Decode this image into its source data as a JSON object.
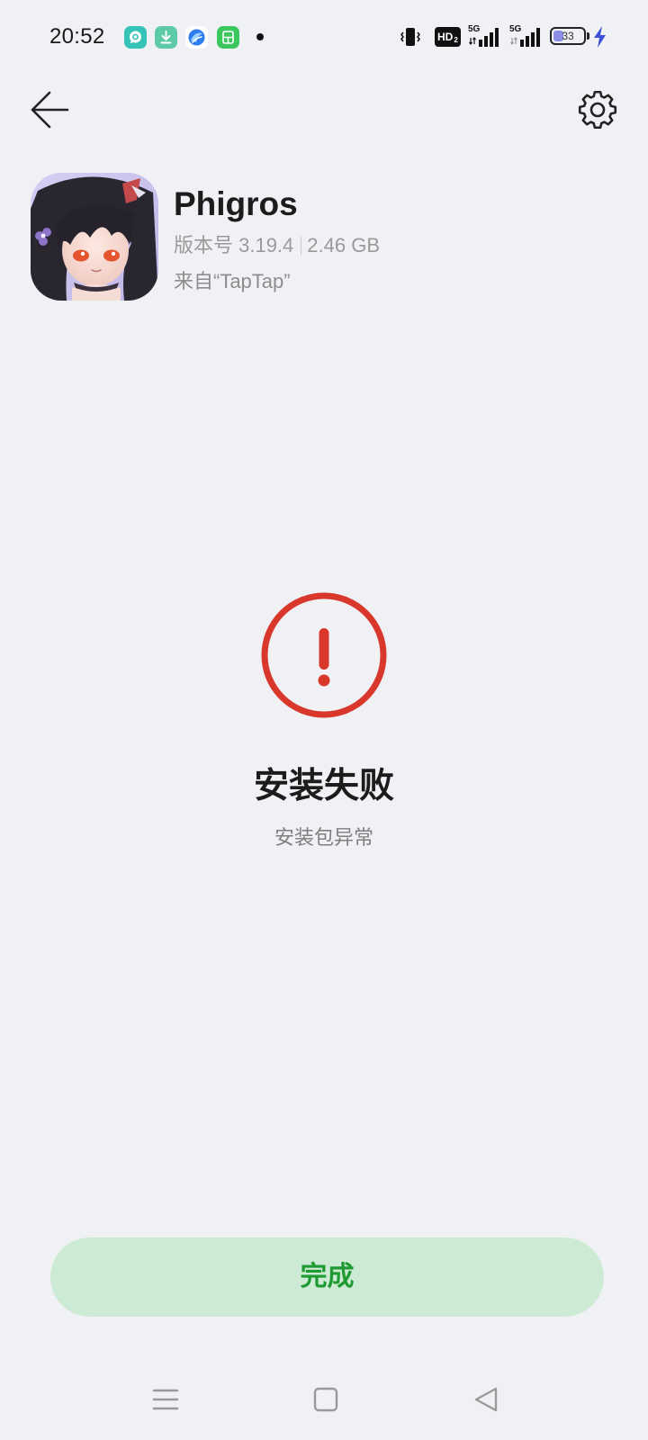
{
  "status_bar": {
    "time": "20:52",
    "notification_icons": [
      "chat-app-icon",
      "download-app-icon",
      "browser-app-icon",
      "calculator-app-icon"
    ],
    "hd_label": "HD",
    "hd_sub": "2",
    "sim1_network": "5G",
    "sim2_network": "5G",
    "battery_level": "33",
    "battery_fraction": 0.33,
    "charging": true
  },
  "header": {
    "back_icon": "back-arrow-icon",
    "settings_icon": "gear-icon"
  },
  "app": {
    "icon": "phigros-app-icon",
    "name": "Phigros",
    "version": "版本号 3.19.4",
    "size": "2.46 GB",
    "source": "来自“TapTap”"
  },
  "result": {
    "status_icon": "error-exclamation-icon",
    "title": "安装失败",
    "message": "安装包异常"
  },
  "actions": {
    "done_label": "完成"
  },
  "nav_bar": {
    "icons": [
      "menu-icon",
      "home-square-icon",
      "back-triangle-icon"
    ]
  },
  "colors": {
    "background": "#f0f1f4",
    "error": "#d9372b",
    "button_bg": "#cdebd4",
    "button_text": "#1f9a33",
    "charging_bolt": "#3b4fd9",
    "battery_fill": "#8b90e6"
  }
}
